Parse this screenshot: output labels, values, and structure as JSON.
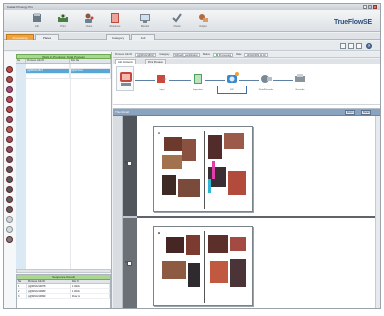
{
  "app": {
    "title": "Kodak Prinergy Pro"
  },
  "toolbar": {
    "brand": "TrueFlowSE",
    "tools": [
      {
        "label": "Job",
        "icon": "job-icon"
      },
      {
        "label": "Print",
        "icon": "printer-icon"
      },
      {
        "label": "Users",
        "icon": "users-icon"
      },
      {
        "label": "Resource",
        "icon": "book-icon"
      },
      {
        "label": "Monitor",
        "icon": "monitor-icon"
      },
      {
        "label": "Check",
        "icon": "check-icon"
      },
      {
        "label": "Output",
        "icon": "output-icon"
      }
    ]
  },
  "tabs": [
    {
      "label": "Processing",
      "active": true
    },
    {
      "label": "Plates",
      "active": false
    },
    {
      "label": "Category",
      "active": false
    },
    {
      "label": "Job",
      "active": false
    }
  ],
  "left": {
    "header": "Work in Progress: Total Process",
    "columns": [
      "No",
      "Process Job ID",
      "File Na"
    ],
    "rows": [
      {
        "no": "",
        "id": "",
        "file": ""
      },
      {
        "no": "",
        "id": "p@W1021817",
        "file": "p@s15mm"
      },
      {
        "no": "",
        "id": "",
        "file": ""
      }
    ],
    "bottom": {
      "title": "Sequence Result",
      "columns": [
        "No",
        "Process Job ID",
        "File N"
      ],
      "rows": [
        {
          "no": "1",
          "id": "p@W10210978",
          "file": "1 Work"
        },
        {
          "no": "2",
          "id": "p@W10210989",
          "file": "1 Work"
        },
        {
          "no": "3",
          "id": "p@W10210999",
          "file": "Flow m"
        }
      ]
    }
  },
  "info": {
    "process_label": "Process Job ID",
    "process_id": "p@W10218817",
    "category_label": "Category",
    "category": "WFlow6_workflowlist",
    "status_label": "Status",
    "status": "Processing",
    "date_label": "Date",
    "date": "10/02/2009 11:40"
  },
  "jobtabs": [
    "Job Contents",
    "Print Preview"
  ],
  "workflow": {
    "nodes": [
      {
        "label": "Input"
      },
      {
        "label": "Imposition"
      },
      {
        "label": "RIP"
      },
      {
        "label": "Plate/Recorder"
      },
      {
        "label": "Recorder"
      }
    ]
  },
  "preview": {
    "title": "Thumbnail",
    "buttons": [
      "Zoom",
      "Detail"
    ],
    "rows": [
      {
        "num": "1",
        "page_label": "A"
      },
      {
        "num": "2",
        "page_label": "B"
      }
    ]
  },
  "colors": {
    "accent_tab": "#f2a23a",
    "header_green": "#a8d78d",
    "selected_row": "#5aa6d6",
    "preview_bar": "#8aa4c0"
  }
}
